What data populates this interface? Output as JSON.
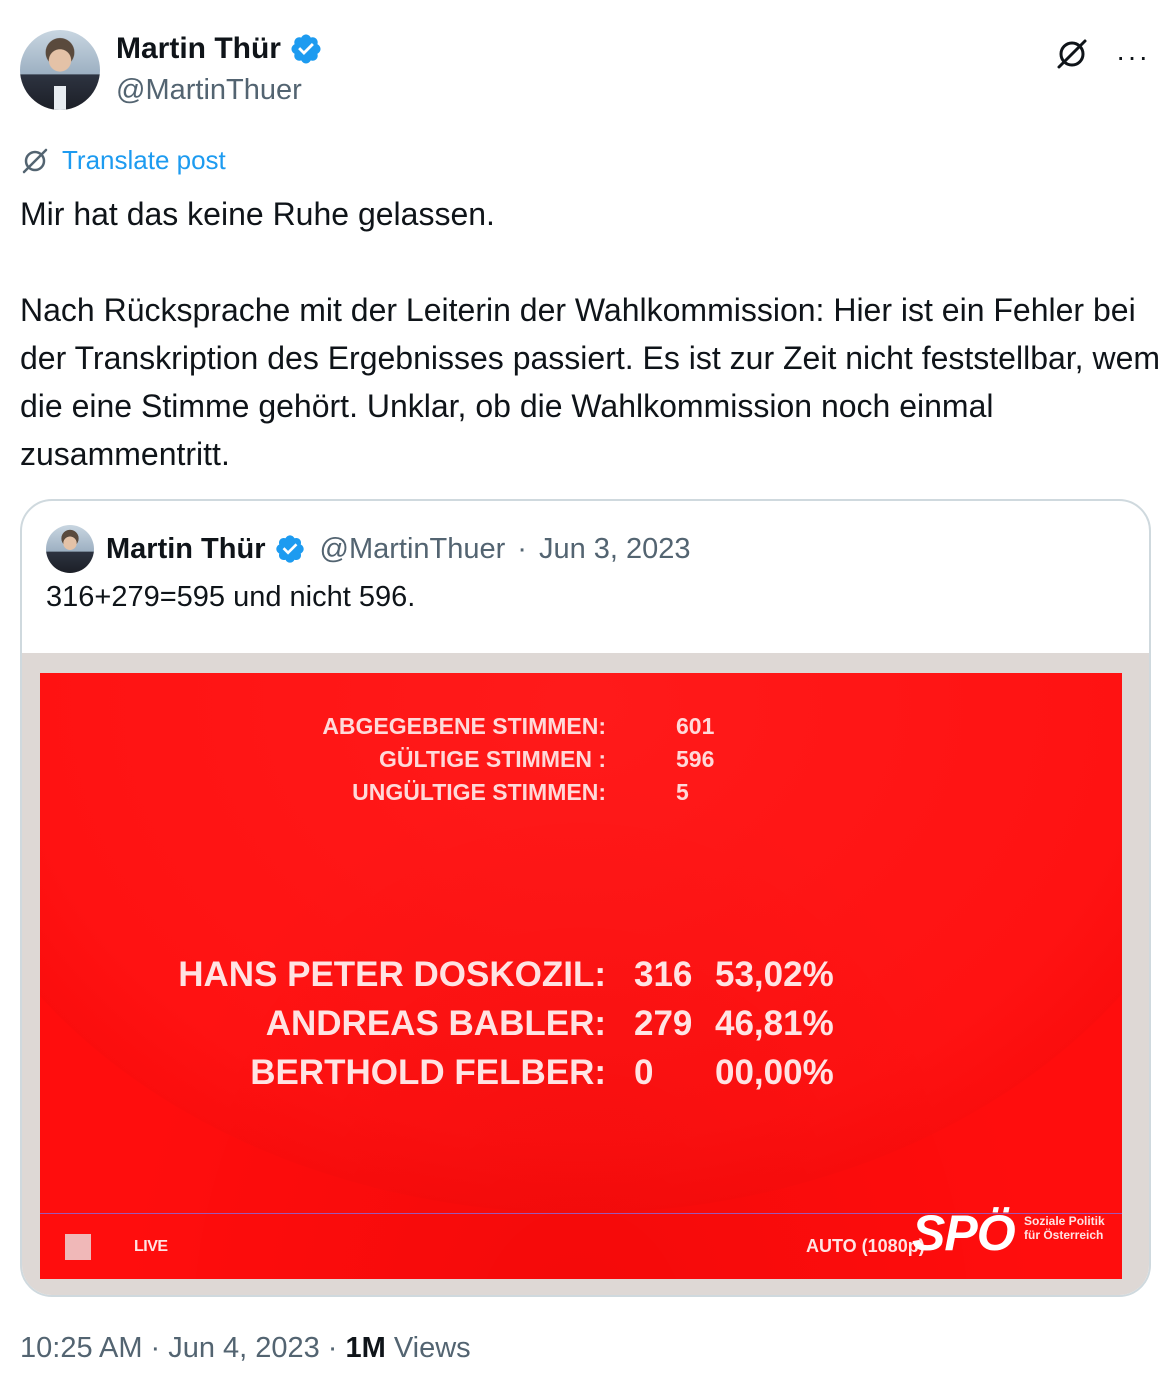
{
  "author": {
    "name": "Martin Thür",
    "handle": "@MartinThuer",
    "verified": true
  },
  "top_actions": {
    "grok_icon": "grok-icon",
    "more_label": "···"
  },
  "translate": {
    "label": "Translate post"
  },
  "tweet": {
    "paragraph1": "Mir hat das keine Ruhe gelassen.",
    "paragraph2": "Nach Rücksprache mit der Leiterin der Wahlkommission: Hier ist ein Fehler bei der Transkription des Ergebnisses passiert. Es ist zur Zeit nicht feststellbar, wem die eine Stimme gehört. Unklar, ob die Wahlkommission noch einmal zusammentritt."
  },
  "quote": {
    "name": "Martin Thür",
    "handle": "@MartinThuer",
    "date": "Jun 3, 2023",
    "separator": "·",
    "text": "316+279=595 und nicht 596.",
    "media": {
      "stats": [
        {
          "label": "ABGEGEBENE STIMMEN:",
          "value": "601"
        },
        {
          "label": "GÜLTIGE STIMMEN :",
          "value": "596"
        },
        {
          "label": "UNGÜLTIGE STIMMEN:",
          "value": "5"
        }
      ],
      "results": [
        {
          "name": "HANS PETER DOSKOZIL:",
          "votes": "316",
          "pct": "53,02%"
        },
        {
          "name": "ANDREAS BABLER:",
          "votes": "279",
          "pct": "46,81%"
        },
        {
          "name": "BERTHOLD FELBER:",
          "votes": "0",
          "pct": "00,00%"
        }
      ],
      "live_label": "LIVE",
      "quality_label": "AUTO (1080p)",
      "logo_text": "SPÖ",
      "logo_tagline": "Soziale Politik für Österreich",
      "colors": {
        "screen": "#ff0d0d",
        "frame": "#ded8d5"
      }
    }
  },
  "footer": {
    "time": "10:25 AM",
    "date": "Jun 4, 2023",
    "separator": "·",
    "views_count": "1M",
    "views_label": "Views"
  },
  "colors": {
    "link": "#1d9bf0",
    "secondary_text": "#536471",
    "primary_text": "#0f1419",
    "verified": "#1d9bf0"
  }
}
